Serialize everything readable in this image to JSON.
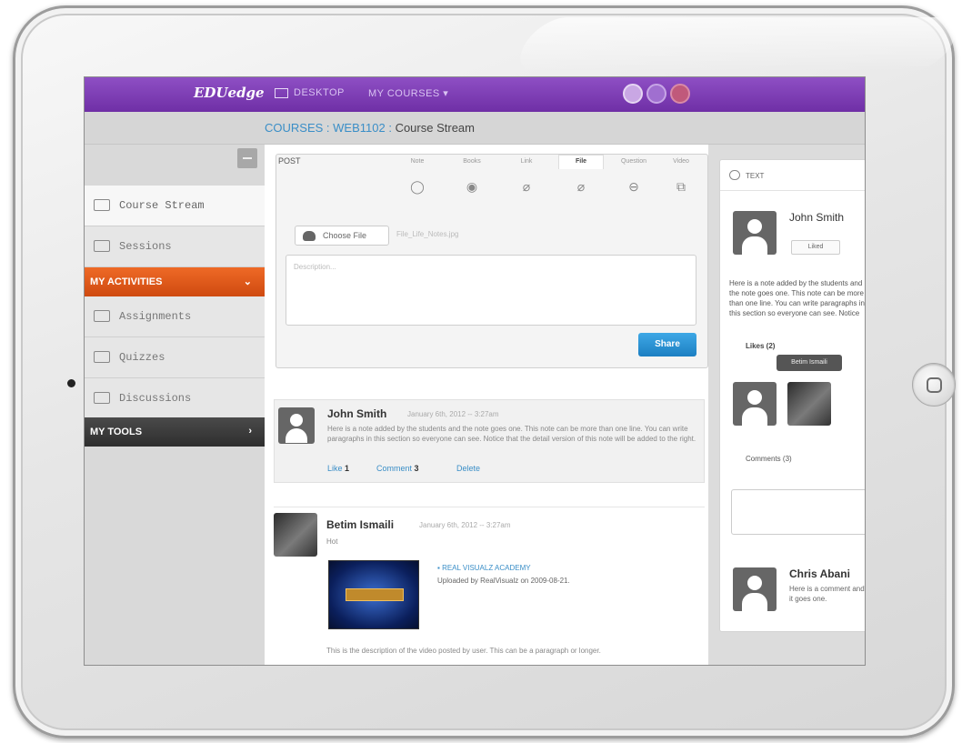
{
  "topbar": {
    "logo": "EDUedge",
    "nav_desktop": "DESKTOP",
    "nav_courses": "MY COURSES ▾",
    "accent": "#7b3bb5"
  },
  "breadcrumb": {
    "part1": "COURSES",
    "sep": " : ",
    "part2": "WEB1102",
    "current": "Course Stream"
  },
  "sidebar": {
    "items": [
      {
        "label": "Course Stream",
        "icon": "monitor-icon"
      },
      {
        "label": "Sessions",
        "icon": "monitor-icon"
      }
    ],
    "activities_header": "MY ACTIVITIES",
    "activities": [
      {
        "label": "Assignments",
        "icon": "assignment-icon"
      },
      {
        "label": "Quizzes",
        "icon": "quiz-icon"
      },
      {
        "label": "Discussions",
        "icon": "discussion-icon"
      }
    ],
    "tools_header": "MY TOOLS",
    "activities_color": "#e0561b",
    "tools_color": "#3a3a3a"
  },
  "post_box": {
    "label": "POST",
    "tabs": [
      "Note",
      "Books",
      "Link",
      "File",
      "Question",
      "Video"
    ],
    "active_tab": "File",
    "choose_file": "Choose File",
    "file_name": "File_Life_Notes.jpg",
    "description_placeholder": "Description...",
    "share": "Share"
  },
  "posts": [
    {
      "name": "John Smith",
      "date": "January 6th, 2012 -- 3:27am",
      "text": "Here is a note added by the students and the note goes one. This note can be more than one line. You can write paragraphs in this section so everyone can see. Notice that the detail version of this note will be added to the right.",
      "like": "Like",
      "like_count": "1",
      "comment": "Comment",
      "comment_count": "3",
      "delete": "Delete"
    },
    {
      "name": "Betim Ismaili",
      "date": "January 6th, 2012 -- 3:27am",
      "text": "Hot",
      "video_title": "REAL VISUALZ ACADEMY",
      "video_sub": "Uploaded by RealVisualz on 2009-08-21.",
      "description": "This is the description of the video posted by user. This can be a paragraph or longer."
    }
  ],
  "detail": {
    "header": "TEXT",
    "name": "John Smith",
    "liked": "Liked",
    "text": "Here is a note added by the students and the note goes one. This note can be more than one line. You can write paragraphs in this section so everyone can see. Notice that the detail version of this note.",
    "likes": "Likes (2)",
    "tooltip": "Betim Ismaili",
    "comments": "Comments (3)",
    "commenter": "Chris Abani",
    "comment_text": "Here is a comment and it goes one."
  }
}
